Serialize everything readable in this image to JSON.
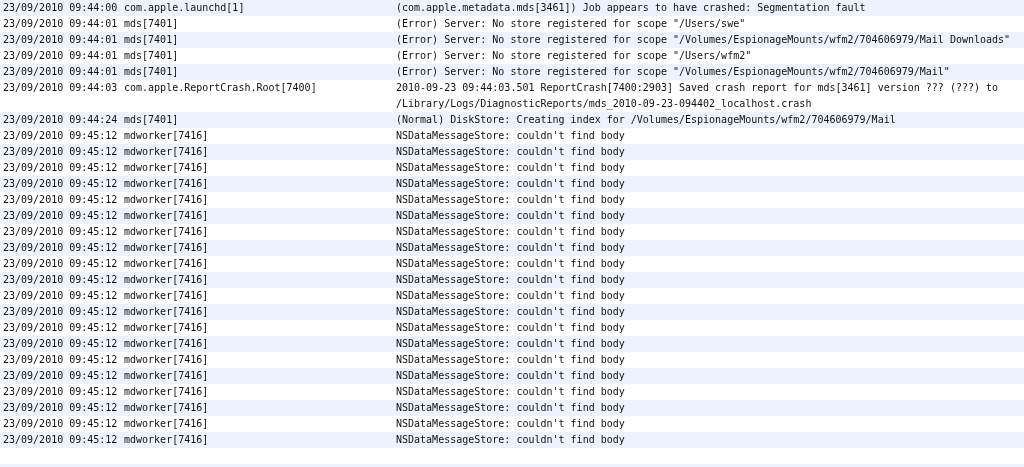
{
  "log_rows": [
    {
      "timestamp": "23/09/2010 09:44:00",
      "process": "com.apple.launchd[1]",
      "message": "(com.apple.metadata.mds[3461]) Job appears to have crashed: Segmentation fault"
    },
    {
      "timestamp": "23/09/2010 09:44:01",
      "process": "mds[7401]",
      "message": "(Error) Server: No store registered for scope \"/Users/swe\""
    },
    {
      "timestamp": "23/09/2010 09:44:01",
      "process": "mds[7401]",
      "message": "(Error) Server: No store registered for scope \"/Volumes/EspionageMounts/wfm2/704606979/Mail Downloads\""
    },
    {
      "timestamp": "23/09/2010 09:44:01",
      "process": "mds[7401]",
      "message": "(Error) Server: No store registered for scope \"/Users/wfm2\""
    },
    {
      "timestamp": "23/09/2010 09:44:01",
      "process": "mds[7401]",
      "message": "(Error) Server: No store registered for scope \"/Volumes/EspionageMounts/wfm2/704606979/Mail\""
    },
    {
      "timestamp": "23/09/2010 09:44:03",
      "process": "com.apple.ReportCrash.Root[7400]",
      "message": "2010-09-23 09:44:03.501 ReportCrash[7400:2903] Saved crash report for mds[3461] version ??? (???) to /Library/Logs/DiagnosticReports/mds_2010-09-23-094402_localhost.crash"
    },
    {
      "timestamp": "23/09/2010 09:44:24",
      "process": "mds[7401]",
      "message": "(Normal) DiskStore: Creating index for /Volumes/EspionageMounts/wfm2/704606979/Mail"
    },
    {
      "timestamp": "23/09/2010 09:45:12",
      "process": "mdworker[7416]",
      "message": "NSDataMessageStore: couldn't find body"
    },
    {
      "timestamp": "23/09/2010 09:45:12",
      "process": "mdworker[7416]",
      "message": "NSDataMessageStore: couldn't find body"
    },
    {
      "timestamp": "23/09/2010 09:45:12",
      "process": "mdworker[7416]",
      "message": "NSDataMessageStore: couldn't find body"
    },
    {
      "timestamp": "23/09/2010 09:45:12",
      "process": "mdworker[7416]",
      "message": "NSDataMessageStore: couldn't find body"
    },
    {
      "timestamp": "23/09/2010 09:45:12",
      "process": "mdworker[7416]",
      "message": "NSDataMessageStore: couldn't find body"
    },
    {
      "timestamp": "23/09/2010 09:45:12",
      "process": "mdworker[7416]",
      "message": "NSDataMessageStore: couldn't find body"
    },
    {
      "timestamp": "23/09/2010 09:45:12",
      "process": "mdworker[7416]",
      "message": "NSDataMessageStore: couldn't find body"
    },
    {
      "timestamp": "23/09/2010 09:45:12",
      "process": "mdworker[7416]",
      "message": "NSDataMessageStore: couldn't find body"
    },
    {
      "timestamp": "23/09/2010 09:45:12",
      "process": "mdworker[7416]",
      "message": "NSDataMessageStore: couldn't find body"
    },
    {
      "timestamp": "23/09/2010 09:45:12",
      "process": "mdworker[7416]",
      "message": "NSDataMessageStore: couldn't find body"
    },
    {
      "timestamp": "23/09/2010 09:45:12",
      "process": "mdworker[7416]",
      "message": "NSDataMessageStore: couldn't find body"
    },
    {
      "timestamp": "23/09/2010 09:45:12",
      "process": "mdworker[7416]",
      "message": "NSDataMessageStore: couldn't find body"
    },
    {
      "timestamp": "23/09/2010 09:45:12",
      "process": "mdworker[7416]",
      "message": "NSDataMessageStore: couldn't find body"
    },
    {
      "timestamp": "23/09/2010 09:45:12",
      "process": "mdworker[7416]",
      "message": "NSDataMessageStore: couldn't find body"
    },
    {
      "timestamp": "23/09/2010 09:45:12",
      "process": "mdworker[7416]",
      "message": "NSDataMessageStore: couldn't find body"
    },
    {
      "timestamp": "23/09/2010 09:45:12",
      "process": "mdworker[7416]",
      "message": "NSDataMessageStore: couldn't find body"
    },
    {
      "timestamp": "23/09/2010 09:45:12",
      "process": "mdworker[7416]",
      "message": "NSDataMessageStore: couldn't find body"
    },
    {
      "timestamp": "23/09/2010 09:45:12",
      "process": "mdworker[7416]",
      "message": "NSDataMessageStore: couldn't find body"
    },
    {
      "timestamp": "23/09/2010 09:45:12",
      "process": "mdworker[7416]",
      "message": "NSDataMessageStore: couldn't find body"
    },
    {
      "timestamp": "23/09/2010 09:45:12",
      "process": "mdworker[7416]",
      "message": "NSDataMessageStore: couldn't find body"
    }
  ]
}
